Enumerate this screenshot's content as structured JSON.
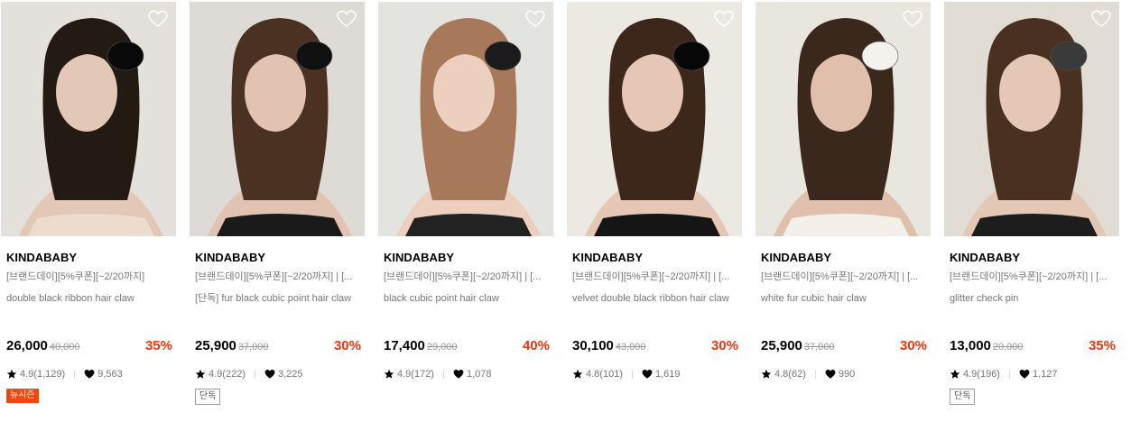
{
  "products": [
    {
      "brand": "KINDABABY",
      "name": "[브랜드데이][5%쿠폰][~2/20까지]",
      "desc": "double black ribbon hair claw",
      "price": "26,000",
      "orig_price": "40,000",
      "discount": "35%",
      "rating": "4.9(1,129)",
      "likes": "9,563",
      "badge": "뉴시즌",
      "badge_type": "new",
      "palette": {
        "bg": "#e4e1dd",
        "hair": "#241a14",
        "skin": "#e3c8b8",
        "accent": "#0a0a0a",
        "cloth": "#ecdcd0"
      }
    },
    {
      "brand": "KINDABABY",
      "name": "[브랜드데이][5%쿠폰][~2/20까지] | [...",
      "desc": "[단독] fur black cubic point hair claw",
      "price": "25,900",
      "orig_price": "37,000",
      "discount": "30%",
      "rating": "4.9(222)",
      "likes": "3,225",
      "badge": "단독",
      "badge_type": "ex",
      "palette": {
        "bg": "#dedad5",
        "hair": "#4a3121",
        "skin": "#e2c3b1",
        "accent": "#101010",
        "cloth": "#1a1a1a"
      }
    },
    {
      "brand": "KINDABABY",
      "name": "[브랜드데이][5%쿠폰][~2/20까지] | [...",
      "desc": "black cubic point hair claw",
      "price": "17,400",
      "orig_price": "29,000",
      "discount": "40%",
      "rating": "4.9(172)",
      "likes": "1,078",
      "badge": "",
      "badge_type": "",
      "palette": {
        "bg": "#e3e4e0",
        "hair": "#a7785a",
        "skin": "#eccfbf",
        "accent": "#1b1b1b",
        "cloth": "#222222"
      }
    },
    {
      "brand": "KINDABABY",
      "name": "[브랜드데이][5%쿠폰][~2/20까지] | [...",
      "desc": "velvet double black ribbon hair claw",
      "price": "30,100",
      "orig_price": "43,000",
      "discount": "30%",
      "rating": "4.8(101)",
      "likes": "1,619",
      "badge": "",
      "badge_type": "",
      "palette": {
        "bg": "#ece9e3",
        "hair": "#3d271b",
        "skin": "#e6c7b5",
        "accent": "#080808",
        "cloth": "#151515"
      }
    },
    {
      "brand": "KINDABABY",
      "name": "[브랜드데이][5%쿠폰][~2/20까지] | [...",
      "desc": "white fur cubic hair claw",
      "price": "25,900",
      "orig_price": "37,000",
      "discount": "30%",
      "rating": "4.8(62)",
      "likes": "990",
      "badge": "",
      "badge_type": "",
      "palette": {
        "bg": "#e9e5df",
        "hair": "#3a281c",
        "skin": "#e0c0ac",
        "accent": "#f4f2ee",
        "cloth": "#f3f0ea"
      }
    },
    {
      "brand": "KINDABABY",
      "name": "[브랜드데이][5%쿠폰][~2/20까지] | [...",
      "desc": "glitter check pin",
      "price": "13,000",
      "orig_price": "20,000",
      "discount": "35%",
      "rating": "4.9(196)",
      "likes": "1,127",
      "badge": "단독",
      "badge_type": "ex",
      "palette": {
        "bg": "#e2ddd4",
        "hair": "#4a3020",
        "skin": "#e4c7b4",
        "accent": "#3a3a3a",
        "cloth": "#1d1d1d"
      }
    }
  ]
}
